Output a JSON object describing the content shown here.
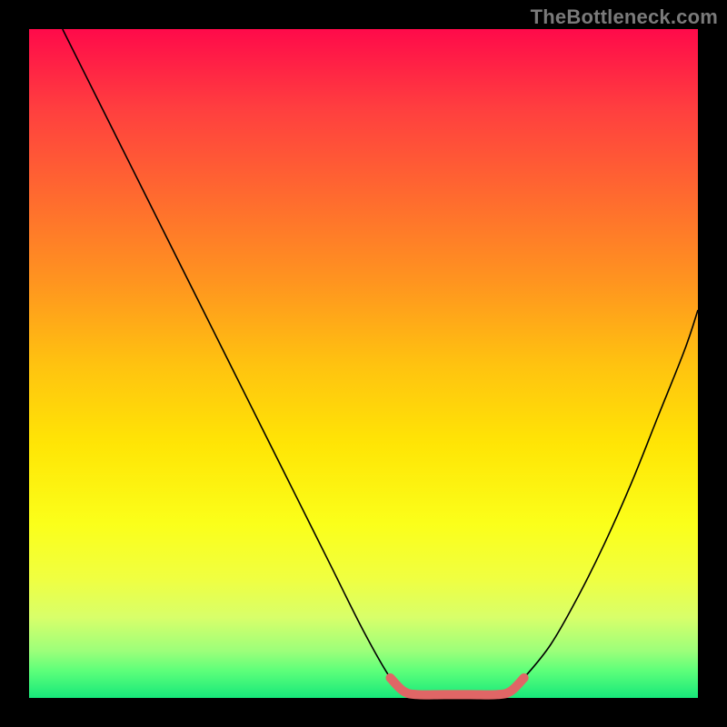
{
  "watermark": {
    "text": "TheBottleneck.com"
  },
  "chart_data": {
    "type": "line",
    "title": "",
    "xlabel": "",
    "ylabel": "",
    "xlim": [
      0,
      100
    ],
    "ylim": [
      0,
      100
    ],
    "grid": false,
    "legend": false,
    "series": [
      {
        "name": "left-curve",
        "x": [
          5,
          10,
          15,
          20,
          25,
          30,
          35,
          40,
          45,
          50,
          54,
          56
        ],
        "y": [
          100,
          90,
          80,
          70,
          60,
          50,
          40,
          30,
          20,
          10,
          3,
          1
        ]
      },
      {
        "name": "right-curve",
        "x": [
          72,
          74,
          78,
          82,
          86,
          90,
          94,
          98,
          100
        ],
        "y": [
          1,
          3,
          8,
          15,
          23,
          32,
          42,
          52,
          58
        ]
      },
      {
        "name": "valley-accent",
        "x": [
          54,
          56,
          58,
          62,
          66,
          70,
          72,
          74
        ],
        "y": [
          3,
          1,
          0.5,
          0.5,
          0.5,
          0.5,
          1,
          3
        ],
        "color": "#e06666"
      }
    ]
  }
}
